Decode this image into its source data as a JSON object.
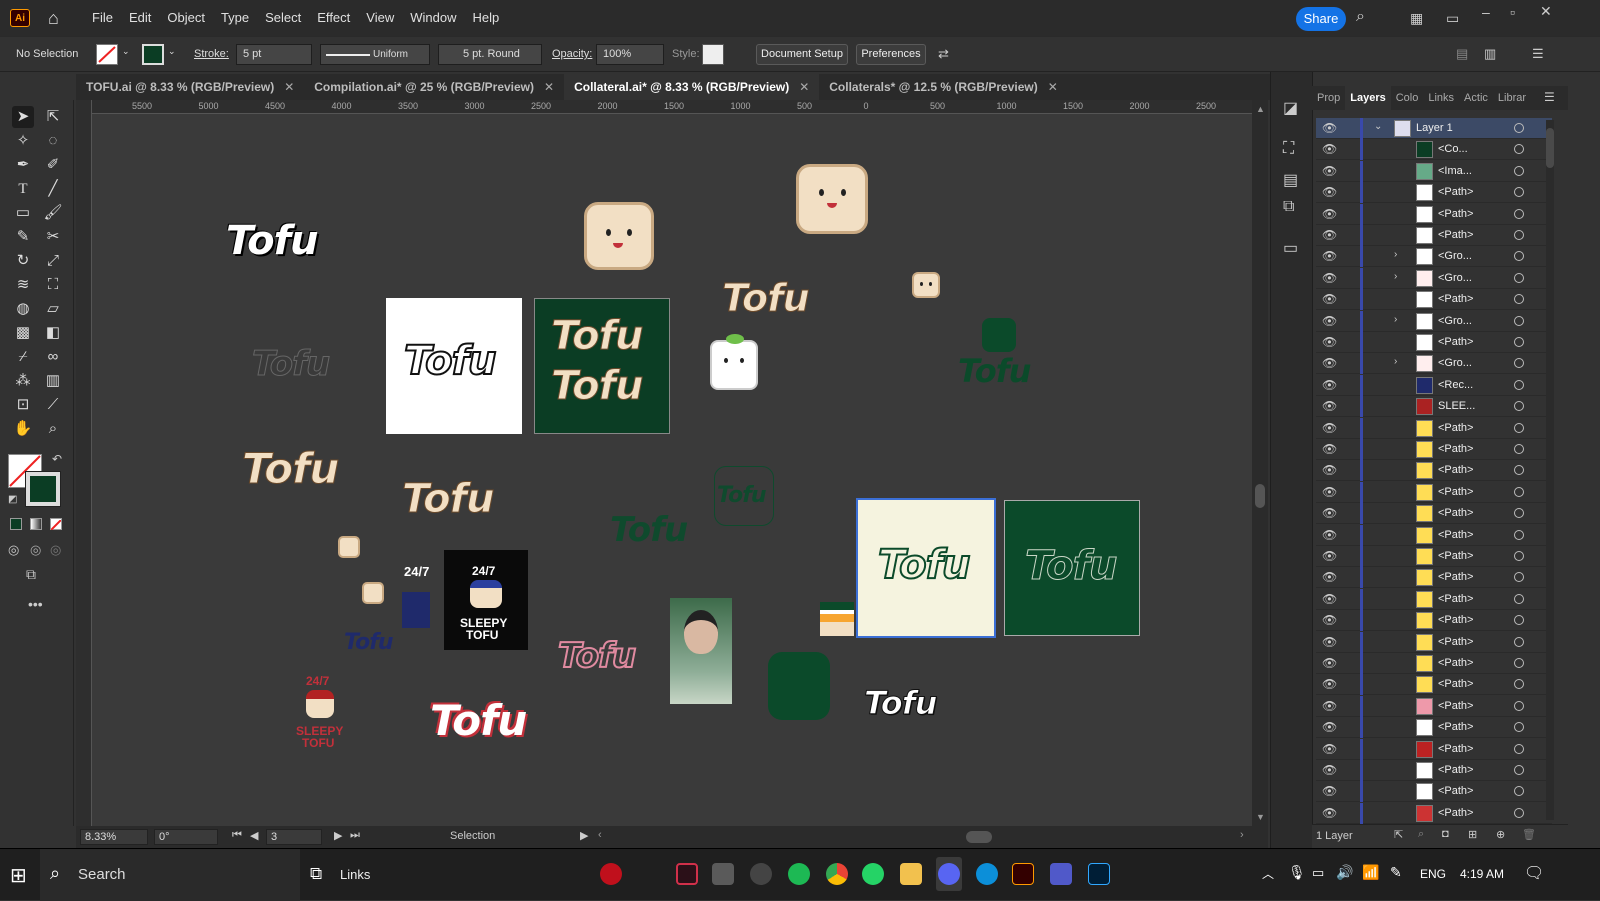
{
  "app": {
    "logo": "Ai",
    "menus": [
      "File",
      "Edit",
      "Object",
      "Type",
      "Select",
      "Effect",
      "View",
      "Window",
      "Help"
    ],
    "share_label": "Share"
  },
  "control": {
    "selection": "No Selection",
    "stroke_label": "Stroke:",
    "stroke_value": "5 pt",
    "profile": "Uniform",
    "brush": "5 pt. Round",
    "opacity_label": "Opacity:",
    "opacity_value": "100%",
    "style_label": "Style:",
    "doc_setup": "Document Setup",
    "preferences": "Preferences"
  },
  "tabs": [
    {
      "label": "TOFU.ai @ 8.33 % (RGB/Preview)",
      "active": false
    },
    {
      "label": "Compilation.ai* @ 25 % (RGB/Preview)",
      "active": false
    },
    {
      "label": "Collateral.ai* @ 8.33 % (RGB/Preview)",
      "active": true
    },
    {
      "label": "Collaterals* @ 12.5 % (RGB/Preview)",
      "active": false
    }
  ],
  "ruler_top": [
    "5500",
    "5000",
    "4500",
    "4000",
    "3500",
    "3000",
    "2500",
    "2000",
    "1500",
    "1000",
    "500",
    "0",
    "500",
    "1000",
    "1500",
    "2000",
    "2500"
  ],
  "artwork": {
    "tofu": "Tofu",
    "sleepy_247": "24/7",
    "sleepy_name": "SLEEPY",
    "sleepy_name2": "TOFU"
  },
  "status": {
    "zoom": "8.33%",
    "rotate": "0°",
    "artboard": "3",
    "tool": "Selection"
  },
  "panel": {
    "tabs": [
      "Prop",
      "Layers",
      "Colo",
      "Links",
      "Actic",
      "Librar"
    ],
    "active_tab": "Layers",
    "layers": [
      {
        "name": "Layer 1",
        "top": true,
        "arrow": "v",
        "thumb": "#dde"
      },
      {
        "name": "<Co...",
        "thumb": "#0b3d24"
      },
      {
        "name": "<Ima...",
        "thumb": "#6a8"
      },
      {
        "name": "<Path>",
        "thumb": "#fff"
      },
      {
        "name": "<Path>",
        "thumb": "#fff"
      },
      {
        "name": "<Path>",
        "thumb": "#fff"
      },
      {
        "name": "<Gro...",
        "arrow": ">",
        "thumb": "#fff"
      },
      {
        "name": "<Gro...",
        "arrow": ">",
        "thumb": "#fee"
      },
      {
        "name": "<Path>",
        "thumb": "#fff"
      },
      {
        "name": "<Gro...",
        "arrow": ">",
        "thumb": "#fff"
      },
      {
        "name": "<Path>",
        "thumb": "#fff"
      },
      {
        "name": "<Gro...",
        "arrow": ">",
        "thumb": "#fee"
      },
      {
        "name": "<Rec...",
        "thumb": "#1f2a6b"
      },
      {
        "name": "SLEE...",
        "thumb": "#a22"
      },
      {
        "name": "<Path>",
        "thumb": "#fd5"
      },
      {
        "name": "<Path>",
        "thumb": "#fd5"
      },
      {
        "name": "<Path>",
        "thumb": "#fd5"
      },
      {
        "name": "<Path>",
        "thumb": "#fd5"
      },
      {
        "name": "<Path>",
        "thumb": "#fd5"
      },
      {
        "name": "<Path>",
        "thumb": "#fd5"
      },
      {
        "name": "<Path>",
        "thumb": "#fd5"
      },
      {
        "name": "<Path>",
        "thumb": "#fd5"
      },
      {
        "name": "<Path>",
        "thumb": "#fd5"
      },
      {
        "name": "<Path>",
        "thumb": "#fd5"
      },
      {
        "name": "<Path>",
        "thumb": "#fd5"
      },
      {
        "name": "<Path>",
        "thumb": "#fd5"
      },
      {
        "name": "<Path>",
        "thumb": "#fd5"
      },
      {
        "name": "<Path>",
        "thumb": "#e9a"
      },
      {
        "name": "<Path>",
        "thumb": "#fff"
      },
      {
        "name": "<Path>",
        "thumb": "#b22"
      },
      {
        "name": "<Path>",
        "thumb": "#fff"
      },
      {
        "name": "<Path>",
        "thumb": "#fff"
      },
      {
        "name": "<Path>",
        "thumb": "#c33"
      }
    ],
    "footer": "1 Layer"
  },
  "taskbar": {
    "search": "Search",
    "links": "Links",
    "lang": "ENG",
    "time": "4:19 AM"
  }
}
